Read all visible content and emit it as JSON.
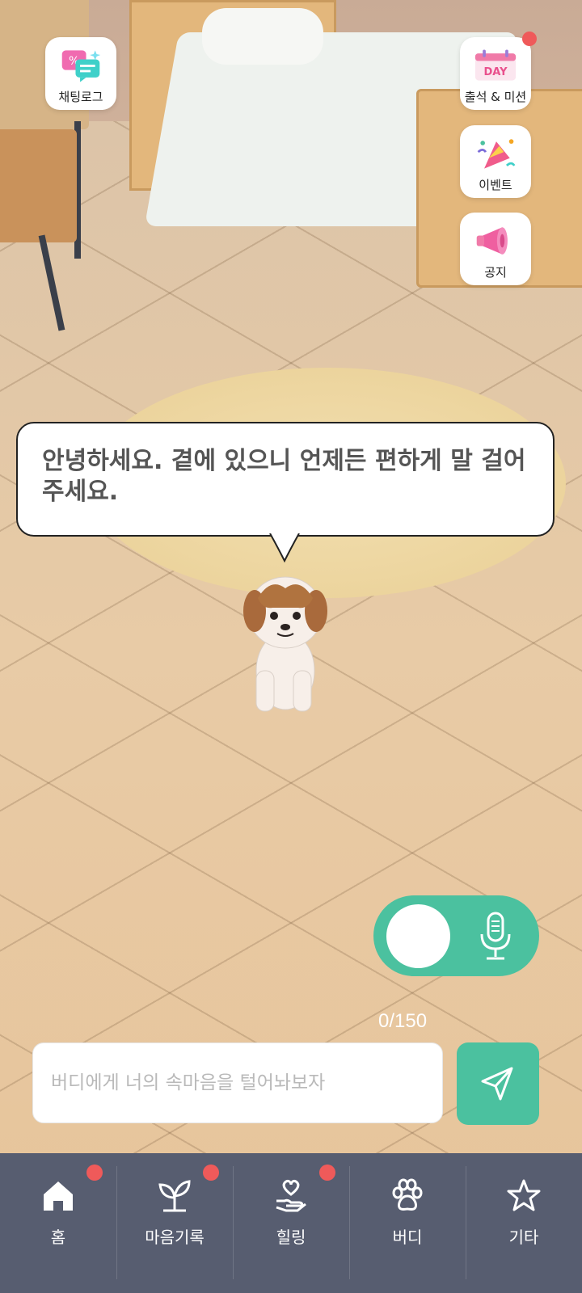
{
  "side_buttons": {
    "chat_log": {
      "label": "채팅로그",
      "icon": "chat-log-icon"
    },
    "attendance": {
      "label": "출석 & 미션",
      "badge_text": "DAY",
      "icon": "calendar-day-icon",
      "has_notification": true
    },
    "event": {
      "label": "이벤트",
      "icon": "party-popper-icon"
    },
    "notice": {
      "label": "공지",
      "icon": "megaphone-icon"
    }
  },
  "speech_bubble": {
    "text": "안녕하세요. 곁에 있으니 언제든 편하게 말 걸어주세요."
  },
  "voice_toggle": {
    "state": "off",
    "icon": "microphone-icon"
  },
  "message": {
    "char_count": "0/150",
    "placeholder": "버디에게 너의 속마음을 털어놔보자",
    "value": ""
  },
  "tabbar": {
    "items": [
      {
        "label": "홈",
        "icon": "home-icon",
        "has_notification": true,
        "active": true
      },
      {
        "label": "마음기록",
        "icon": "sprout-icon",
        "has_notification": true
      },
      {
        "label": "힐링",
        "icon": "heart-hand-icon",
        "has_notification": true
      },
      {
        "label": "버디",
        "icon": "paw-icon",
        "has_notification": false
      },
      {
        "label": "기타",
        "icon": "star-icon",
        "has_notification": false
      }
    ]
  },
  "colors": {
    "accent": "#4bc19f",
    "tabbar_bg": "#575d70",
    "notification": "#ef5a5a"
  }
}
